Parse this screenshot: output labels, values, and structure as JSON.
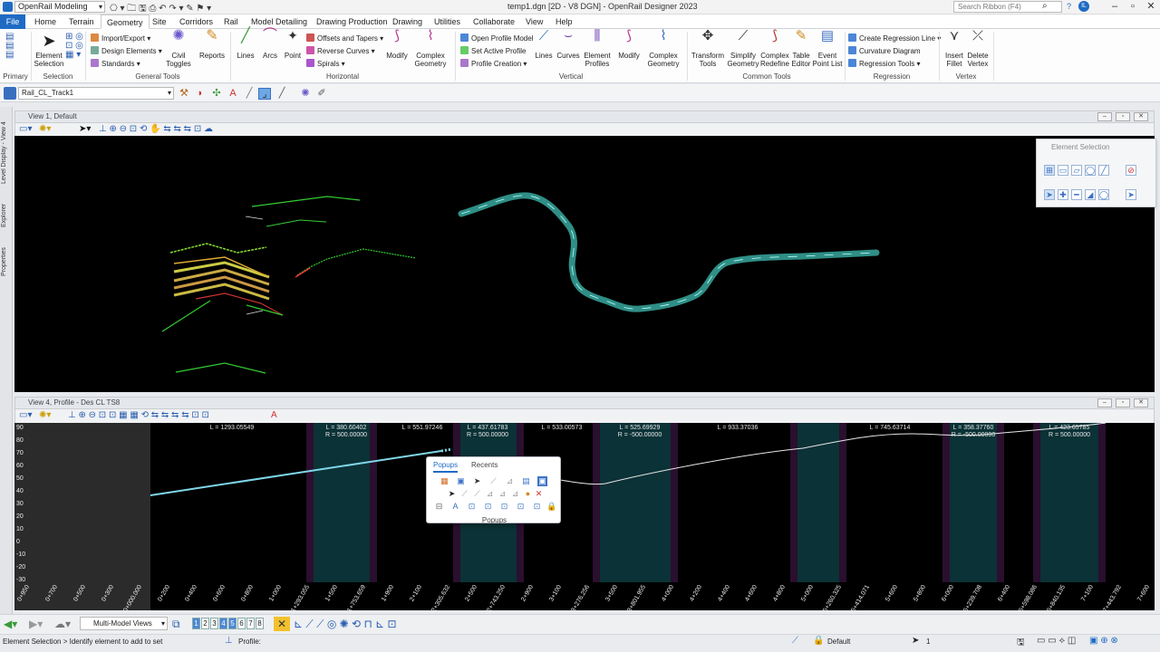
{
  "app": {
    "workspace": "OpenRail Modeling",
    "title": "temp1.dgn [2D - V8 DGN] - OpenRail Designer 2023",
    "search_placeholder": "Search Ribbon (F4)"
  },
  "tabs": [
    "File",
    "Home",
    "Terrain",
    "Geometry",
    "Site",
    "Corridors",
    "Rail",
    "Model Detailing",
    "Drawing Production",
    "Drawing",
    "Utilities",
    "Collaborate",
    "View",
    "Help"
  ],
  "active_tab": "Geometry",
  "ribbon": {
    "primary_label": "Primary",
    "selection": {
      "label": "Selection",
      "element_selection": "Element Selection"
    },
    "general_tools": {
      "label": "General Tools",
      "import_export": "Import/Export",
      "design_elements": "Design Elements",
      "standards": "Standards",
      "civil_toggles": "Civil Toggles",
      "reports": "Reports"
    },
    "horizontal": {
      "label": "Horizontal",
      "lines": "Lines",
      "arcs": "Arcs",
      "point": "Point",
      "offsets_tapers": "Offsets and Tapers",
      "reverse_curves": "Reverse Curves",
      "spirals": "Spirals",
      "modify": "Modify",
      "complex_geometry": "Complex Geometry"
    },
    "vertical": {
      "label": "Vertical",
      "open_profile_model": "Open Profile Model",
      "set_active_profile": "Set Active Profile",
      "profile_creation": "Profile Creation",
      "lines": "Lines",
      "curves": "Curves",
      "element_profiles": "Element Profiles",
      "modify": "Modify",
      "complex_geometry": "Complex Geometry"
    },
    "common_tools": {
      "label": "Common Tools",
      "transform_tools": "Transform Tools",
      "simplify_geometry": "Simplify Geometry",
      "complex_redefine": "Complex Redefine",
      "table_editor": "Table Editor",
      "event_point_list": "Event Point List"
    },
    "regression": {
      "label": "Regression",
      "create_regression_line": "Create Regression Line",
      "curvature_diagram": "Curvature Diagram",
      "regression_tools": "Regression Tools"
    },
    "vertex": {
      "label": "Vertex",
      "insert_fillet": "Insert Fillet",
      "delete_vertex": "Delete Vertex"
    }
  },
  "toolrow": {
    "model": "Rail_CL_Track1"
  },
  "left_rail": [
    "Level Display - View 4",
    "Explorer",
    "Properties"
  ],
  "view1": {
    "title": "View 1, Default"
  },
  "view4": {
    "title": "View 4, Profile - Des CL TS8"
  },
  "element_selection_panel": {
    "title": "Element Selection"
  },
  "profile": {
    "segments": [
      {
        "l": "L = 1293.05549"
      },
      {
        "l": "L = 380.60402",
        "r": "R = 500.00000"
      },
      {
        "l": "L = 551.97246"
      },
      {
        "l": "L = 437.61783",
        "r": "R = 500.00000"
      },
      {
        "l": "L = 533.00573"
      },
      {
        "l": "L = 525.69929",
        "r": "R = -500.00000"
      },
      {
        "l": "L = 933.37036"
      },
      {
        "l": "L = 745.63714"
      },
      {
        "l": "L = 358.37760",
        "r": "R = -500.00000"
      },
      {
        "l": "L = 423.65785",
        "r": "R = 500.00000"
      }
    ],
    "y_ticks": [
      "90",
      "80",
      "70",
      "60",
      "50",
      "40",
      "30",
      "20",
      "10",
      "0",
      "-10",
      "-20",
      "-30"
    ],
    "x_ticks": [
      "0+950",
      "0+700",
      "0+500",
      "0+300",
      "0+000.000",
      "0+200",
      "0+400",
      "0+600",
      "0+800",
      "1+000",
      "1+293.055",
      "1+500",
      "1+753.659",
      "1+900",
      "2+100",
      "2+305.632",
      "2+500",
      "2+743.250",
      "2+900",
      "3+100",
      "3+276.256",
      "3+500",
      "3+801.955",
      "4+000",
      "4+200",
      "4+400",
      "4+600",
      "4+800",
      "5+000",
      "5+260.325",
      "5+414.071",
      "5+600",
      "5+800",
      "6+000",
      "6+239.708",
      "6+400",
      "6+598.086",
      "6+840.135",
      "7+100",
      "7+443.792",
      "7+600"
    ]
  },
  "popup": {
    "tabs": [
      "Popups",
      "Recents"
    ],
    "footer": "Popups"
  },
  "bottom": {
    "views_dropdown": "Multi-Model Views",
    "view_numbers": [
      "1",
      "2",
      "3",
      "4",
      "5",
      "6",
      "7",
      "8"
    ],
    "active_views": [
      "1",
      "4",
      "5"
    ]
  },
  "status": {
    "prompt": "Element Selection > Identify element to add to set",
    "profile": "Profile:",
    "level": "Default",
    "count": "1"
  },
  "colors": {
    "accent": "#1f6bc4",
    "alignment": "#2f8f86",
    "profile_line": "#7fd6e8",
    "band": "#0b3236"
  }
}
